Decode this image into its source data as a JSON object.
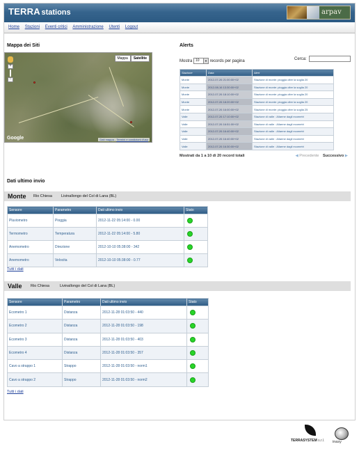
{
  "header": {
    "brand_terra": "TERRA",
    "brand_stations": "stations",
    "partner_logo_text": "arpav"
  },
  "nav": {
    "items": [
      "Home",
      "Stazioni",
      "Eventi critici",
      "Amministrazione",
      "Utenti",
      "Logout"
    ]
  },
  "map_section": {
    "title": "Mappa dei Siti",
    "map_button": "Mappa",
    "satellite_button": "Satellite",
    "google_label": "Google",
    "attribution_data": "Dati mappa",
    "attribution_terms": "Termini e condizioni d'uso"
  },
  "alerts": {
    "title": "Alerts",
    "show_label": "Mostra",
    "page_size": "10",
    "records_label": "records per pagina",
    "search_label": "Cerca:",
    "columns": [
      "Stazione",
      "Data",
      "Alert"
    ],
    "rows": [
      [
        "Monte",
        "2012-07-26 21:00:00+02",
        "Stazione di monte: pioggia oltre la soglia 20"
      ],
      [
        "Monte",
        "2012-08-16 13:30:00+02",
        "Stazione di monte: pioggia oltre la soglia 20"
      ],
      [
        "Monte",
        "2012-07-26 18:10:00+02",
        "Stazione di monte: pioggia oltre la soglia 20"
      ],
      [
        "Monte",
        "2012-07-26 18:20:00+02",
        "Stazione di monte: pioggia oltre la soglia 20"
      ],
      [
        "Monte",
        "2012-07-26 16:00:00+02",
        "Stazione di monte: pioggia oltre la soglia 25"
      ],
      [
        "Valle",
        "2012-07-26 17:10:00+02",
        "Stazione di valle : Allarme dagli ecometri"
      ],
      [
        "Valle",
        "2012-07-26 16:51:00+02",
        "Stazione di valle : Allarme dagli ecometri"
      ],
      [
        "Valle",
        "2012-07-26 16:40:00+02",
        "Stazione di valle : Allarme dagli ecometri"
      ],
      [
        "Valle",
        "2012-07-26 16:40:00+02",
        "Stazione di valle : Allarme dagli ecometri"
      ],
      [
        "Valle",
        "2012-07-26 16:30:00+02",
        "Stazione di valle : Allarme dagli ecometri"
      ]
    ],
    "footer_info": "Mostrati da 1 a 10 di 20 record totali",
    "prev_label": "Precedente",
    "next_label": "Successivo"
  },
  "last_data_title": "Dati ultimo invio",
  "stations": [
    {
      "name": "Monte",
      "river": "Rio Chiesa",
      "location": "Livinallongo del Col di Lana (BL)",
      "columns": [
        "Sensore",
        "Parametro",
        "Dati ultimo invio",
        "Stato"
      ],
      "rows": [
        [
          "Pluviometro",
          "Pioggia",
          "2012-11-22 05:14:00 - 0.00"
        ],
        [
          "Termometro",
          "Temperatura",
          "2012-11-22 05:14:00 - 5.80"
        ],
        [
          "Anemometro",
          "Direzione",
          "2012-10-10 05:38:00 - 342"
        ],
        [
          "Anemometro",
          "Velocita",
          "2012-10-10 05:38:00 - 0.77"
        ]
      ],
      "link_all": "Tutti i dati"
    },
    {
      "name": "Valle",
      "river": "Rio Chiesa",
      "location": "Livinallongo del Col di Lana (BL)",
      "columns": [
        "Sensore",
        "Parametro",
        "Dati ultimo invio",
        "Stato"
      ],
      "rows": [
        [
          "Ecometro 1",
          "Distanza",
          "2012-11-28 01:03:50 - 440"
        ],
        [
          "Ecometro 2",
          "Distanza",
          "2012-11-28 01:03:50 - 198"
        ],
        [
          "Ecometro 3",
          "Distanza",
          "2012-11-28 01:03:50 - 403"
        ],
        [
          "Ecometro 4",
          "Distanza",
          "2012-11-28 01:03:50 - 357"
        ],
        [
          "Cavo a strappo 1",
          "Strappo",
          "2012-11-28 01:03:50 - norm1"
        ],
        [
          "Cavo a strappo 2",
          "Strappo",
          "2012-11-28 01:03:50 - norm2"
        ]
      ],
      "link_all": "Tutti i dati"
    }
  ],
  "footer": {
    "terrasystem_label": "TERRASYSTEM",
    "terrasystem_suffix": "s.r.l.",
    "inkasy_label": "inasy"
  },
  "colors": {
    "header_blue": "#36648d",
    "link_blue": "#1d3f9a",
    "status_ok": "#28d528"
  }
}
